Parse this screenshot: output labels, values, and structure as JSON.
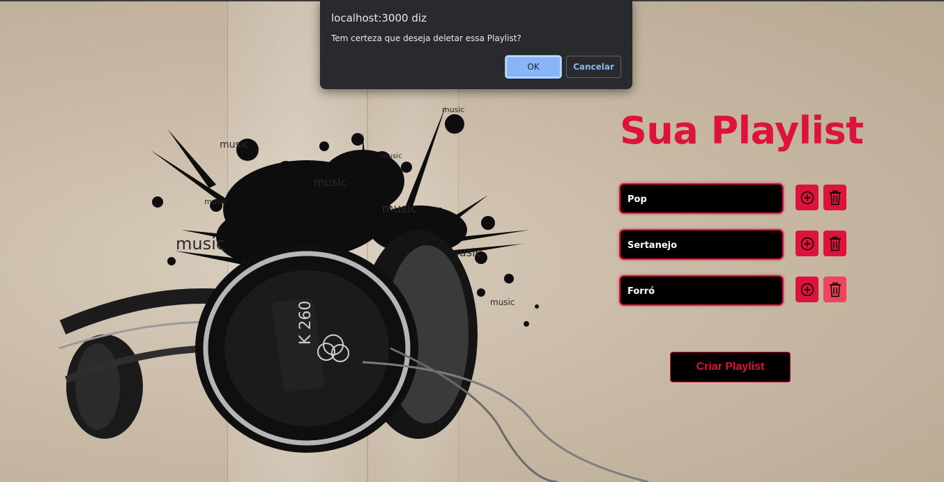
{
  "dialog": {
    "origin": "localhost:3000 diz",
    "message": "Tem certeza que deseja deletar essa Playlist?",
    "ok_label": "OK",
    "cancel_label": "Cancelar"
  },
  "page": {
    "title": "Sua Playlist",
    "playlists": [
      {
        "name": "Pop",
        "add_icon": "plus-circle-icon",
        "delete_icon": "trash-icon"
      },
      {
        "name": "Sertanejo",
        "add_icon": "plus-circle-icon",
        "delete_icon": "trash-icon"
      },
      {
        "name": "Forró",
        "add_icon": "plus-circle-icon",
        "delete_icon": "trash-icon"
      }
    ],
    "create_label": "Criar Playlist"
  },
  "background": {
    "words": [
      "music",
      "music",
      "music",
      "music",
      "music",
      "music",
      "music",
      "music",
      "music"
    ],
    "headphone_model": "K 260"
  },
  "colors": {
    "accent": "#dc143c",
    "field_bg": "#000000",
    "dialog_bg": "#292a2d",
    "dialog_ok": "#8ab4f8"
  }
}
